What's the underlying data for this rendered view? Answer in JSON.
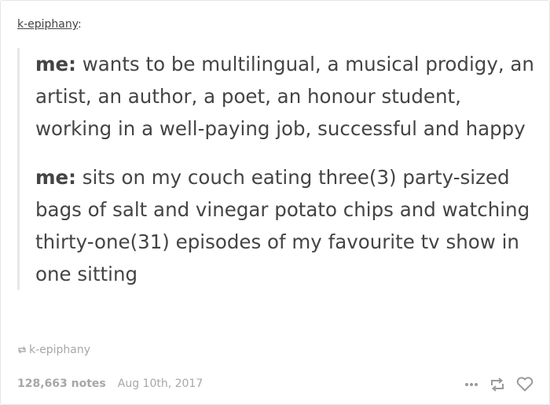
{
  "post": {
    "author": "k-epiphany",
    "author_suffix": ":",
    "quotes": [
      {
        "speaker": "me:",
        "text": " wants to be multilingual, a musical prodigy, an artist, an author, a poet, an honour student, working in a well-paying job, successful and happy"
      },
      {
        "speaker": "me:",
        "text": " sits on my couch eating three(3) party-sized bags of salt and vinegar potato chips and watching thirty-one(31) episodes of my favourite tv show in one sitting"
      }
    ],
    "source": "k-epiphany",
    "notes": "128,663 notes",
    "date": "Aug 10th, 2017"
  },
  "icons": {
    "source": "reblog-icon",
    "more": "more-icon",
    "reblog": "reblog-icon",
    "like": "heart-icon"
  },
  "colors": {
    "text": "#444444",
    "muted": "#a7a7a7",
    "quote_border": "#e7e7e7",
    "card_border": "#e6e6e6"
  }
}
